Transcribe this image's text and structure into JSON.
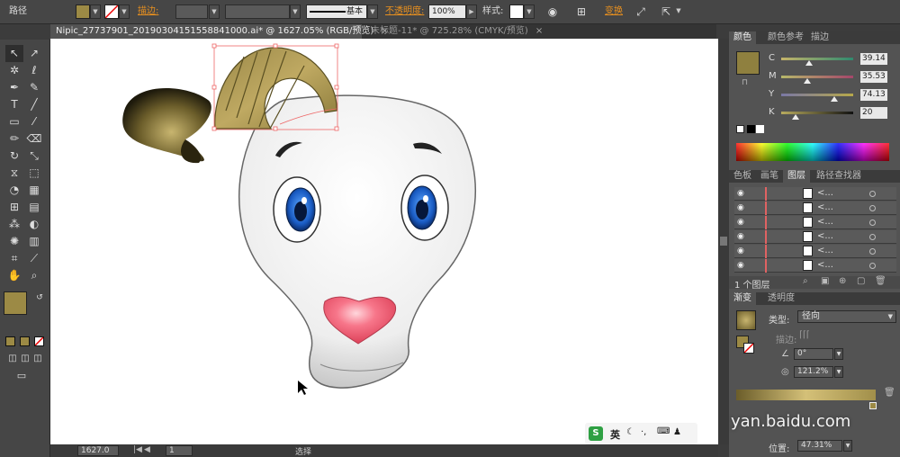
{
  "control_bar": {
    "path_label": "路径",
    "stroke_label": "描边:",
    "stroke_style": "基本",
    "opacity_label": "不透明度:",
    "opacity_value": "100%",
    "style_label": "样式:",
    "transform_label": "变换",
    "fill_color": "#9c8a45"
  },
  "tabs": [
    {
      "label": "Nipic_27737901_20190304151558841000.ai* @ 1627.05% (RGB/预览)",
      "close": "×"
    },
    {
      "label": "未标题-11* @ 725.28% (CMYK/预览)",
      "close": "×"
    }
  ],
  "color_panel": {
    "tabs": [
      "颜色",
      "颜色参考",
      "描边"
    ],
    "channels": [
      {
        "name": "C",
        "value": "39.14",
        "fraction": 0.39
      },
      {
        "name": "M",
        "value": "35.53",
        "fraction": 0.36
      },
      {
        "name": "Y",
        "value": "74.13",
        "fraction": 0.74
      },
      {
        "name": "K",
        "value": "20",
        "fraction": 0.2
      }
    ],
    "swatch": "#8f803f"
  },
  "layers_panel": {
    "tabs": [
      "色板",
      "画笔",
      "图层",
      "路径查找器"
    ],
    "rows": [
      {
        "name": "<..."
      },
      {
        "name": "<..."
      },
      {
        "name": "<..."
      },
      {
        "name": "<..."
      },
      {
        "name": "<..."
      },
      {
        "name": "<..."
      }
    ],
    "count_label": "1 个图层"
  },
  "gradient_panel": {
    "tabs": [
      "渐变",
      "透明度"
    ],
    "type_label": "类型:",
    "type_value": "径向",
    "stroke_label": "描边:",
    "angle_value": "0°",
    "ratio_value": "121.2%",
    "position_label": "位置:",
    "position_value": "47.31%"
  },
  "status_bar": {
    "zoom": "1627.0",
    "page": "1",
    "tool": "选择"
  },
  "overlay": {
    "watermark": "yan.baidu.com",
    "ime_label": "英"
  }
}
